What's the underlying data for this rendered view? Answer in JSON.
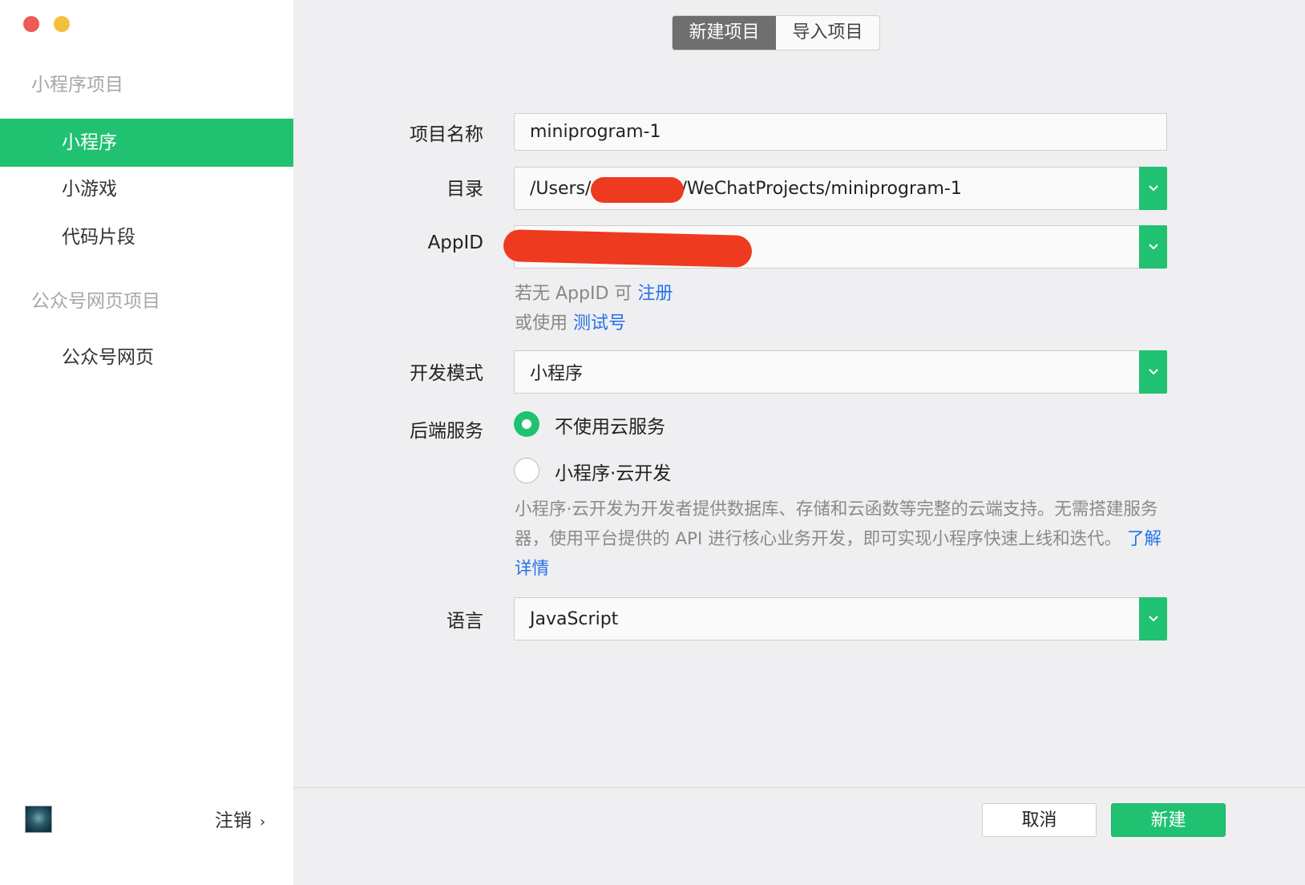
{
  "sidebar": {
    "section_miniprogram": "小程序项目",
    "items": [
      {
        "label": "小程序",
        "active": true
      },
      {
        "label": "小游戏",
        "active": false
      },
      {
        "label": "代码片段",
        "active": false
      }
    ],
    "section_official": "公众号网页项目",
    "official_items": [
      {
        "label": "公众号网页"
      }
    ],
    "logout_label": "注销"
  },
  "tabs": {
    "new_project": "新建项目",
    "import_project": "导入项目"
  },
  "form": {
    "project_name": {
      "label": "项目名称",
      "value": "miniprogram-1"
    },
    "directory": {
      "label": "目录",
      "value_prefix": "/Users/",
      "value_suffix": "/WeChatProjects/miniprogram-1"
    },
    "appid": {
      "label": "AppID",
      "hint1_text": "若无 AppID 可 ",
      "hint1_link": "注册",
      "hint2_text": "或使用 ",
      "hint2_link": "测试号"
    },
    "dev_mode": {
      "label": "开发模式",
      "value": "小程序"
    },
    "backend": {
      "label": "后端服务",
      "option1": "不使用云服务",
      "option2": "小程序·云开发",
      "selected": "不使用云服务",
      "description": "小程序·云开发为开发者提供数据库、存储和云函数等完整的云端支持。无需搭建服务器，使用平台提供的 API 进行核心业务开发，即可实现小程序快速上线和迭代。",
      "learn_more": "了解详情"
    },
    "language": {
      "label": "语言",
      "value": "JavaScript"
    }
  },
  "footer": {
    "cancel_label": "取消",
    "create_label": "新建"
  },
  "colors": {
    "accent": "#21c172",
    "link": "#2472e8",
    "redaction": "#ee3a1f"
  }
}
